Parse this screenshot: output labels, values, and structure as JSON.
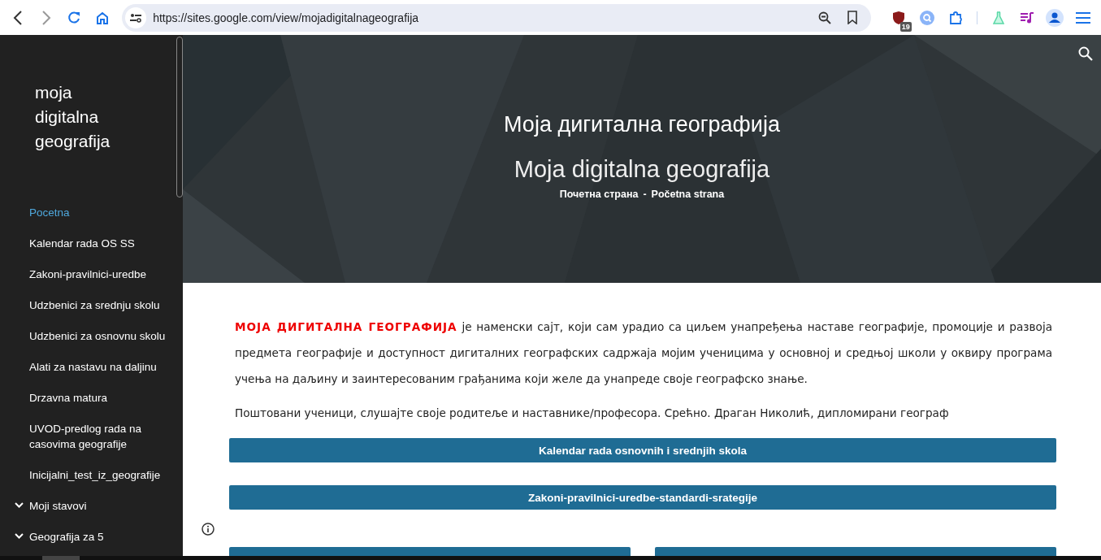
{
  "browser": {
    "url": "https://sites.google.com/view/mojadigitalnageografija",
    "extension_badge": "19"
  },
  "sidebar": {
    "site_title": "moja digitalna geografija",
    "items": [
      {
        "label": "Pocetna",
        "kind": "link",
        "selected": true
      },
      {
        "label": "Kalendar rada OS SS",
        "kind": "link",
        "selected": false
      },
      {
        "label": "Zakoni-pravilnici-uredbe",
        "kind": "link",
        "selected": false
      },
      {
        "label": "Udzbenici za srednju skolu",
        "kind": "link",
        "selected": false
      },
      {
        "label": "Udzbenici za osnovnu skolu",
        "kind": "link",
        "selected": false
      },
      {
        "label": "Alati za nastavu na daljinu",
        "kind": "link",
        "selected": false
      },
      {
        "label": "Drzavna matura",
        "kind": "link",
        "selected": false
      },
      {
        "label": "UVOD-predlog rada na casovima geografije",
        "kind": "link",
        "selected": false
      },
      {
        "label": "Inicijalni_test_iz_geografije",
        "kind": "link",
        "selected": false
      },
      {
        "label": "Moji stavovi",
        "kind": "group",
        "selected": false
      },
      {
        "label": "Geografija za 5",
        "kind": "group",
        "selected": false
      }
    ]
  },
  "hero": {
    "title": "Моја дигитална географија",
    "subtitle": "Moja digitalna geografija",
    "breadcrumb": [
      "Почетна страна",
      "-",
      "Početna strana"
    ]
  },
  "content": {
    "paragraphs": [
      "**МОЈА  ДИГИТАЛНА  ГЕОГРАФИЈА** је наменски сајт, који сам урадио са циљем унапређења наставе географије, промоције и развоја предмета географије и доступност дигиталних географских садржаја мојим ученицима у основној и средњој школи у оквиру програма учења на даљину и заинтересованим грађанима који желе да унапреде своје географско знање.",
      "Поштовани ученици, слушајте своје родитеље и наставнике/професора. Срећно. Драган Николић, дипломирани географ"
    ],
    "buttons": [
      {
        "kind": "full",
        "label": "Kalendar rada osnovnih i srednjih skola"
      },
      {
        "kind": "full",
        "label": "Zakoni-pravilnici-uredbe-standardi-srategije"
      },
      {
        "kind": "half"
      },
      {
        "kind": "half"
      }
    ]
  }
}
